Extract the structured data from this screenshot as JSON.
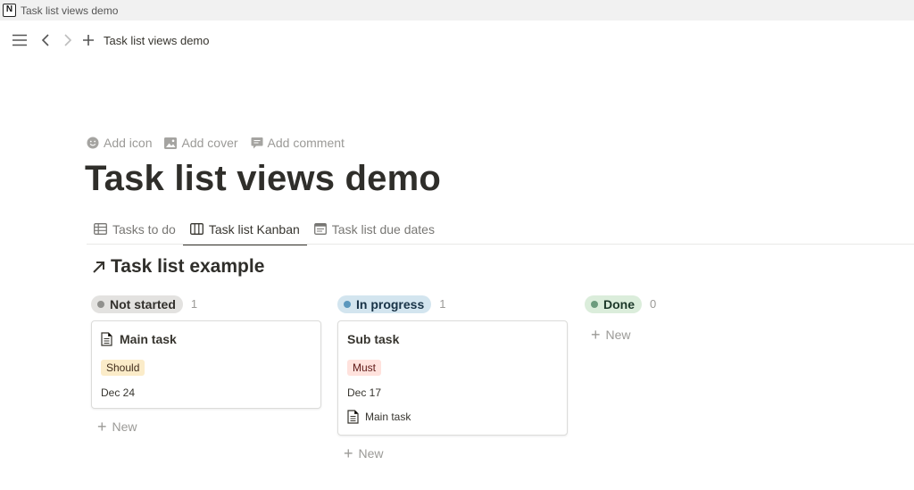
{
  "window": {
    "title": "Task list views demo",
    "app_logo": "N"
  },
  "topbar": {
    "breadcrumb": "Task list views demo"
  },
  "page_actions": {
    "add_icon": "Add icon",
    "add_cover": "Add cover",
    "add_comment": "Add comment"
  },
  "page": {
    "title": "Task list views demo"
  },
  "tabs": [
    {
      "label": "Tasks to do",
      "icon": "table-icon"
    },
    {
      "label": "Task list Kanban",
      "icon": "board-icon",
      "active": true
    },
    {
      "label": "Task list due dates",
      "icon": "calendar-icon"
    }
  ],
  "database": {
    "title": "Task list example",
    "icon": "arrow-up-right-icon"
  },
  "columns": [
    {
      "status": "Not started",
      "count": "1",
      "pill_bg": "#e3e2e0",
      "dot": "#91918e",
      "text": "#32302c",
      "cards": [
        {
          "title": "Main task",
          "tag": "Should",
          "tag_bg": "#fbecc9",
          "tag_text": "#402c1b",
          "date": "Dec 24"
        }
      ],
      "new_label": "New"
    },
    {
      "status": "In progress",
      "count": "1",
      "pill_bg": "#d3e5ef",
      "dot": "#5b97bd",
      "text": "#183347",
      "cards": [
        {
          "title": "Sub task",
          "tag": "Must",
          "tag_bg": "#ffe2dd",
          "tag_text": "#5d1715",
          "date": "Dec 17",
          "related": "Main task"
        }
      ],
      "new_label": "New"
    },
    {
      "status": "Done",
      "count": "0",
      "pill_bg": "#dbeddb",
      "dot": "#6c9b7d",
      "text": "#1c3829",
      "cards": [],
      "new_label": "New"
    }
  ]
}
